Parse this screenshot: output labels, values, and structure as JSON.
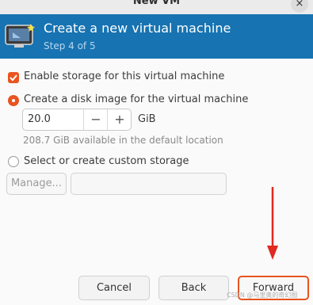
{
  "window": {
    "title": "New VM",
    "close": "×"
  },
  "banner": {
    "heading": "Create a new virtual machine",
    "step": "Step 4 of 5"
  },
  "storage": {
    "enable_label": "Enable storage for this virtual machine",
    "enable_checked": true,
    "disk_option_label": "Create a disk image for the virtual machine",
    "disk_selected": true,
    "size_value": "20.0",
    "minus": "−",
    "plus": "+",
    "size_unit": "GiB",
    "available_hint": "208.7 GiB available in the default location",
    "custom_option_label": "Select or create custom storage",
    "manage_label": "Manage...",
    "custom_path_value": ""
  },
  "footer": {
    "cancel": "Cancel",
    "back": "Back",
    "forward": "Forward"
  },
  "accent_color": "#e95420",
  "banner_color": "#1773b1",
  "annotation_color": "#e02a20",
  "watermark": "CSDN @马里奥的奇幻图"
}
